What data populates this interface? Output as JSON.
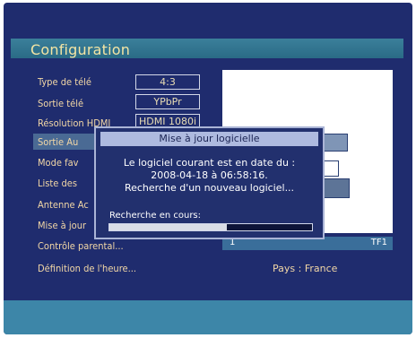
{
  "header": {
    "title": "Configuration"
  },
  "menu": {
    "items": [
      "Type de télé",
      "Sortie télé",
      "Résolution HDMI",
      "Sortie Au",
      "Mode fav",
      "Liste des",
      "Antenne Ac",
      "Mise à jour",
      "Contrôle parental...",
      "Définition de l'heure..."
    ],
    "values": [
      "4:3",
      "YPbPr",
      "HDMI 1080i"
    ]
  },
  "preview": {
    "channel_number": "1",
    "channel_name": "TF1",
    "country": "Pays : France"
  },
  "dialog": {
    "title": "Mise à jour logicielle",
    "line1": "Le logiciel courant est en date du :",
    "line2": "2008-04-18 à 06:58:16.",
    "line3": "Recherche d'un nouveau logiciel...",
    "progress_label": "Recherche en cours:",
    "progress": 0.58
  }
}
